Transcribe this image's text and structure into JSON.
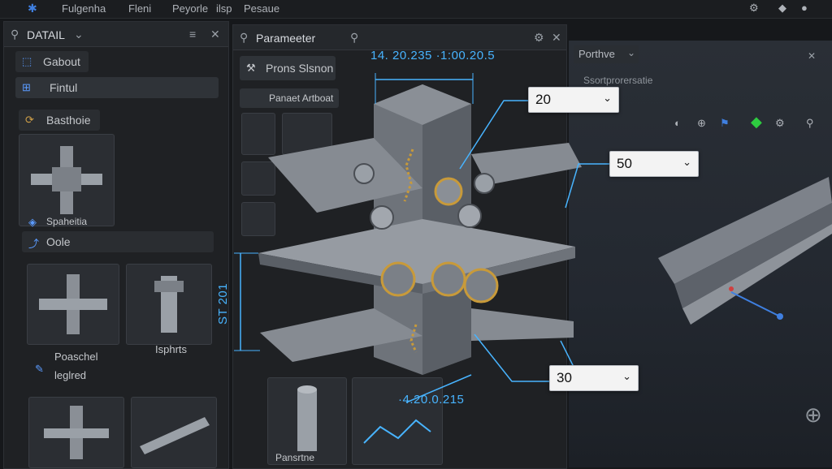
{
  "menubar": {
    "items": [
      "Fulgenha",
      "Fleni",
      "Peyorle",
      "ilsp",
      "Pesaue"
    ]
  },
  "left_panel": {
    "title": "DATAIL",
    "tree": [
      {
        "label": "Gabout"
      },
      {
        "label": "Fintul"
      },
      {
        "label": "Basthoie"
      },
      {
        "label": "Spaheitia"
      },
      {
        "label": "Oole"
      }
    ],
    "thumb_labels": [
      {
        "label": "Poaschel"
      },
      {
        "label": "leglred"
      },
      {
        "label": "Isphrts"
      }
    ]
  },
  "param_panel": {
    "title": "Parameeter",
    "prop_button": "Prons Slsnon",
    "sub_button": "Panaet Artboat",
    "footer_label": "Pansrtne"
  },
  "viewport": {
    "tab": "Porthve",
    "subtitle": "Ssortprorersatie"
  },
  "dimensions": {
    "top": "14. 20.235 ·1:00.20.5",
    "left": "ST 201",
    "bottom": "·4.20.0.215"
  },
  "dropdowns": [
    {
      "value": "20"
    },
    {
      "value": "50"
    },
    {
      "value": "30"
    }
  ],
  "colors": {
    "accent": "#3f7fe0",
    "dimension": "#48b4ff",
    "steel": "#6e737a",
    "weld": "#c89a3a"
  }
}
